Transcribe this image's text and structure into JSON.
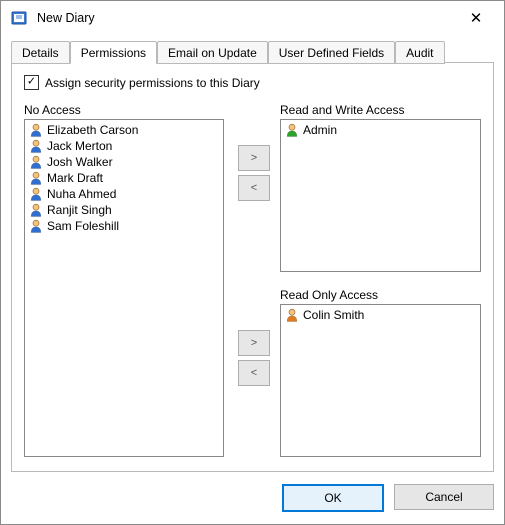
{
  "window": {
    "title": "New Diary",
    "close_glyph": "✕"
  },
  "tabs": [
    {
      "label": "Details",
      "active": false
    },
    {
      "label": "Permissions",
      "active": true
    },
    {
      "label": "Email on Update",
      "active": false
    },
    {
      "label": "User Defined Fields",
      "active": false
    },
    {
      "label": "Audit",
      "active": false
    }
  ],
  "permissions": {
    "assign_label": "Assign security permissions to this Diary",
    "assign_checked": true,
    "no_access_label": "No Access",
    "read_write_label": "Read and Write Access",
    "read_only_label": "Read Only Access",
    "no_access_users": [
      {
        "name": "Elizabeth Carson",
        "icon": "user-blue"
      },
      {
        "name": "Jack Merton",
        "icon": "user-blue"
      },
      {
        "name": "Josh Walker",
        "icon": "user-blue"
      },
      {
        "name": "Mark Draft",
        "icon": "user-blue"
      },
      {
        "name": "Nuha Ahmed",
        "icon": "user-blue"
      },
      {
        "name": "Ranjit Singh",
        "icon": "user-blue"
      },
      {
        "name": "Sam Foleshill",
        "icon": "user-blue"
      }
    ],
    "read_write_users": [
      {
        "name": "Admin",
        "icon": "user-green"
      }
    ],
    "read_only_users": [
      {
        "name": "Colin Smith",
        "icon": "user-orange"
      }
    ],
    "arrow_right_glyph": ">",
    "arrow_left_glyph": "<"
  },
  "buttons": {
    "ok": "OK",
    "cancel": "Cancel"
  },
  "icon_colors": {
    "user-blue": {
      "head": "#f4c27a",
      "body": "#2f6fd0"
    },
    "user-green": {
      "head": "#f4c27a",
      "body": "#2aa52a"
    },
    "user-orange": {
      "head": "#f4c27a",
      "body": "#e07b1f"
    }
  }
}
